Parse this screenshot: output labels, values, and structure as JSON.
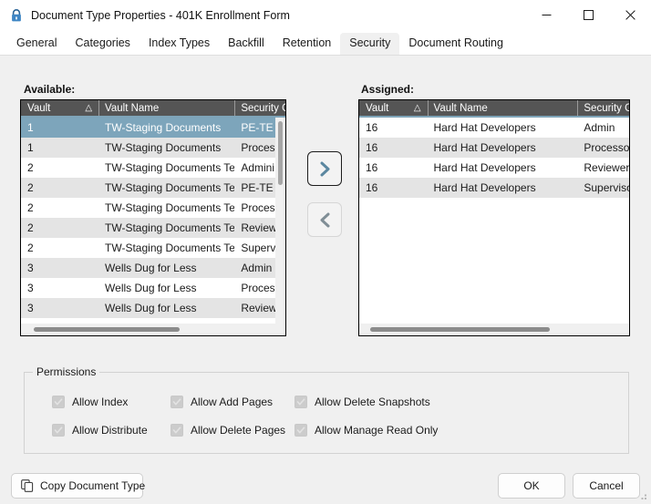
{
  "window": {
    "title": "Document Type Properties  - 401K Enrollment Form",
    "lock_icon": "lock-icon",
    "minimize_label": "Minimize",
    "maximize_label": "Maximize",
    "close_label": "Close"
  },
  "tabs": [
    {
      "label": "General",
      "active": false
    },
    {
      "label": "Categories",
      "active": false
    },
    {
      "label": "Index Types",
      "active": false
    },
    {
      "label": "Backfill",
      "active": false
    },
    {
      "label": "Retention",
      "active": false
    },
    {
      "label": "Security",
      "active": true
    },
    {
      "label": "Document Routing",
      "active": false
    }
  ],
  "available": {
    "label": "Available:",
    "columns": [
      "Vault",
      "Vault Name",
      "Security G"
    ],
    "sort_indicator": "△",
    "rows": [
      {
        "vault": "1",
        "name": "TW-Staging Documents",
        "group": "PE-TE",
        "selected": true
      },
      {
        "vault": "1",
        "name": "TW-Staging Documents",
        "group": "Proces",
        "selected": false
      },
      {
        "vault": "2",
        "name": "TW-Staging Documents Test",
        "group": "Admini",
        "selected": false
      },
      {
        "vault": "2",
        "name": "TW-Staging Documents Test",
        "group": "PE-TE",
        "selected": false
      },
      {
        "vault": "2",
        "name": "TW-Staging Documents Test",
        "group": "Proces",
        "selected": false
      },
      {
        "vault": "2",
        "name": "TW-Staging Documents Test",
        "group": "Review",
        "selected": false
      },
      {
        "vault": "2",
        "name": "TW-Staging Documents Test",
        "group": "Superv",
        "selected": false
      },
      {
        "vault": "3",
        "name": "Wells Dug for Less",
        "group": "Admin",
        "selected": false
      },
      {
        "vault": "3",
        "name": "Wells Dug for Less",
        "group": "Proces",
        "selected": false
      },
      {
        "vault": "3",
        "name": "Wells Dug for Less",
        "group": "Review",
        "selected": false
      }
    ]
  },
  "assigned": {
    "label": "Assigned:",
    "columns": [
      "Vault",
      "Vault Name",
      "Security G"
    ],
    "sort_indicator": "△",
    "rows": [
      {
        "vault": "16",
        "name": "Hard Hat Developers",
        "group": "Admin",
        "selected": false
      },
      {
        "vault": "16",
        "name": "Hard Hat Developers",
        "group": "Processor",
        "selected": false
      },
      {
        "vault": "16",
        "name": "Hard Hat Developers",
        "group": "Reviewers",
        "selected": false
      },
      {
        "vault": "16",
        "name": "Hard Hat Developers",
        "group": "Superviso",
        "selected": false
      }
    ]
  },
  "transfer": {
    "assign_label": "Assign",
    "unassign_label": "Unassign"
  },
  "permissions": {
    "title": "Permissions",
    "items": [
      {
        "label": "Allow Index",
        "checked": true
      },
      {
        "label": "Allow Distribute",
        "checked": true
      },
      {
        "label": "Allow Add Pages",
        "checked": true
      },
      {
        "label": "Allow Delete Pages",
        "checked": true
      },
      {
        "label": "Allow Delete Snapshots",
        "checked": true
      },
      {
        "label": "Allow Manage Read Only",
        "checked": true
      }
    ]
  },
  "footer": {
    "copy_label": "Copy Document Type",
    "ok_label": "OK",
    "cancel_label": "Cancel"
  },
  "colors": {
    "selection": "#7da5bb",
    "header": "#555555",
    "accent_arrow": "#5b87a0",
    "dialog_bg": "#f0f0f0"
  }
}
